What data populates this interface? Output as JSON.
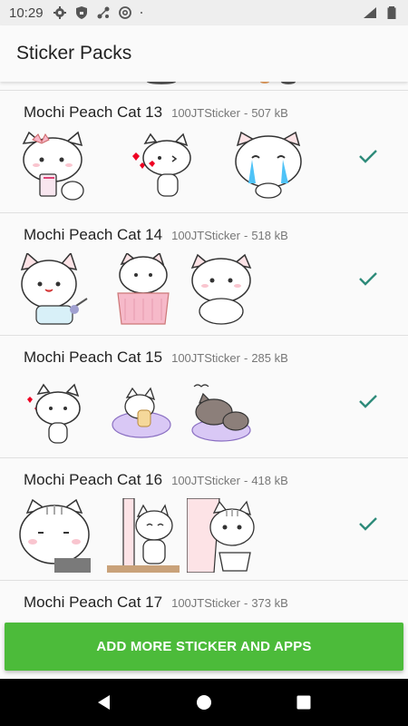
{
  "status_bar": {
    "time": "10:29",
    "icons": [
      "settings-icon",
      "shield-icon",
      "network-icon",
      "at-icon",
      "dot-icon"
    ],
    "right_icons": [
      "wifi-icon",
      "battery-icon"
    ]
  },
  "app_bar": {
    "title": "Sticker Packs"
  },
  "packs": [
    {
      "name": "Mochi Peach Cat 13",
      "publisher": "100JTSticker",
      "separator": "-",
      "size": "507 kB",
      "added": true
    },
    {
      "name": "Mochi Peach Cat 14",
      "publisher": "100JTSticker",
      "separator": "-",
      "size": "518 kB",
      "added": true
    },
    {
      "name": "Mochi Peach Cat 15",
      "publisher": "100JTSticker",
      "separator": "-",
      "size": "285 kB",
      "added": true
    },
    {
      "name": "Mochi Peach Cat 16",
      "publisher": "100JTSticker",
      "separator": "-",
      "size": "418 kB",
      "added": true
    },
    {
      "name": "Mochi Peach Cat 17",
      "publisher": "100JTSticker",
      "separator": "-",
      "size": "373 kB",
      "added": false
    }
  ],
  "add_button": {
    "label": "ADD MORE STICKER AND APPS"
  },
  "nav_bar": {
    "icons": [
      "back-icon",
      "home-icon",
      "recents-icon"
    ]
  },
  "colors": {
    "accent": "#4cbb3a",
    "check": "#2e8b7a"
  }
}
